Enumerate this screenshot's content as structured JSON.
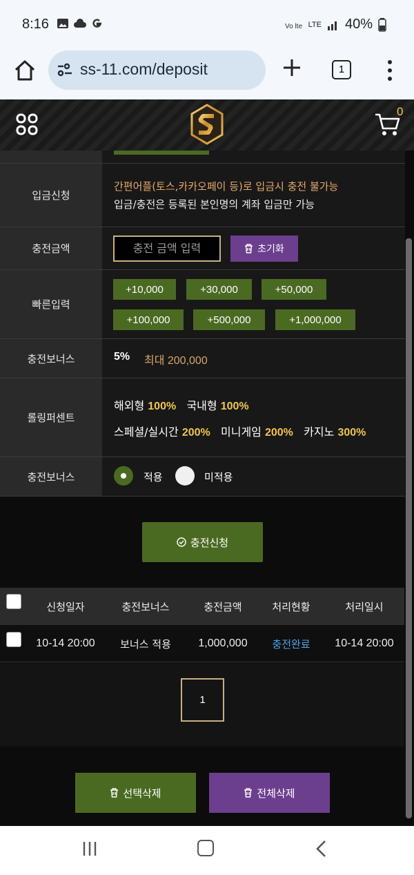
{
  "status_bar": {
    "time": "8:16",
    "network": "LTE",
    "battery": "40%"
  },
  "browser": {
    "url": "ss-11.com/deposit",
    "tab_count": "1"
  },
  "header": {
    "cart_count": "0"
  },
  "form": {
    "rows": {
      "apply_label": "입금신청",
      "notice_warning": "간편어플(토스,카카오페이 등)로 입금시 충전 불가능",
      "notice_info": "입금/충전은 등록된 본인명의 계좌 입금만 가능",
      "amount_label": "충전금액",
      "amount_placeholder": "충전 금액 입력",
      "reset_label": "초기화",
      "quick_label": "빠른입력",
      "quick_amounts": [
        "+10,000",
        "+30,000",
        "+50,000",
        "+100,000",
        "+500,000",
        "+1,000,000"
      ],
      "bonus_label": "충전보너스",
      "bonus_percent": "5%",
      "bonus_max": "최대 200,000",
      "rolling_label": "롤링퍼센트",
      "rolling": {
        "overseas_label": "해외형",
        "overseas_value": "100%",
        "domestic_label": "국내형",
        "domestic_value": "100%",
        "special_label": "스페셜/실시간",
        "special_value": "200%",
        "minigame_label": "미니게임",
        "minigame_value": "200%",
        "casino_label": "카지노",
        "casino_value": "300%"
      },
      "bonus_apply_label": "충전보너스",
      "option_apply": "적용",
      "option_no_apply": "미적용"
    },
    "submit_label": "충전신청"
  },
  "history": {
    "columns": [
      "신청일자",
      "충전보너스",
      "충전금액",
      "처리현황",
      "처리일시"
    ],
    "rows": [
      {
        "date": "10-14 20:00",
        "bonus": "보너스 적용",
        "amount": "1,000,000",
        "status": "충전완료",
        "processed": "10-14 20:00"
      }
    ],
    "page": "1"
  },
  "actions": {
    "delete_selected": "선택삭제",
    "delete_all": "전체삭제"
  },
  "colors": {
    "green": "#4a6a22",
    "purple": "#6b3f8e",
    "gold": "#f0c550",
    "status_blue": "#4da3e6"
  }
}
